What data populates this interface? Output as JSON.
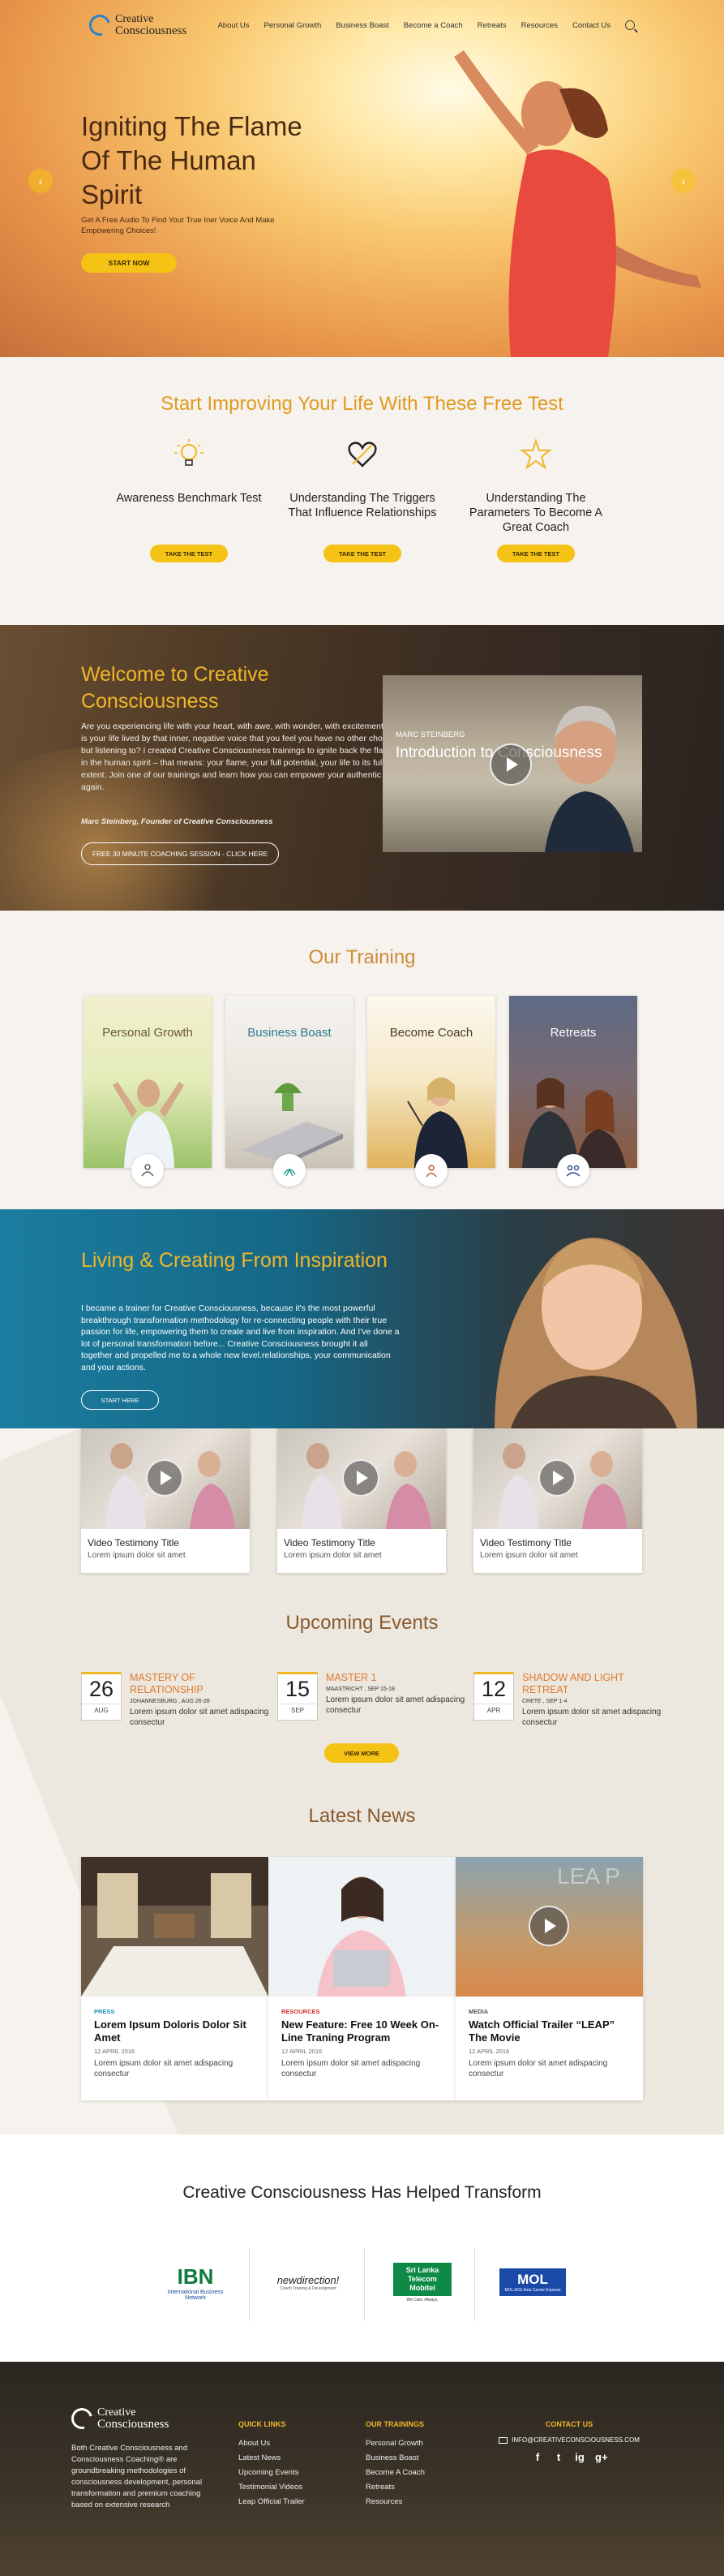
{
  "header": {
    "logo_line1": "Creative",
    "logo_line2": "Consciousness",
    "nav": [
      "About Us",
      "Personal Growth",
      "Business Boast",
      "Become a Coach",
      "Retreats",
      "Resources",
      "Contact Us"
    ]
  },
  "hero": {
    "title": "Igniting The Flame Of The Human Spirit",
    "subtitle": "Get A Free Audio To Find Your True Iner Voice And Make Empowering Choices!",
    "cta": "START NOW",
    "prev": "‹",
    "next": "›"
  },
  "free_test": {
    "title": "Start Improving Your Life With These Free Test",
    "items": [
      {
        "label": "Awareness Benchmark Test",
        "button": "TAKE THE TEST",
        "icon": "lightbulb-icon"
      },
      {
        "label": "Understanding The Triggers That Influence Relationships",
        "button": "TAKE THE TEST",
        "icon": "heart-icon"
      },
      {
        "label": "Understanding The Parameters To Become A Great Coach",
        "button": "TAKE THE TEST",
        "icon": "star-icon"
      }
    ]
  },
  "welcome": {
    "title": "Welcome to Creative Consciousness",
    "body": "Are you experiencing life with your heart, with awe, with wonder, with excitement? Or is your life lived by that inner, negative voice that you feel you have no other choice but listening to? I created Creative Consciousness trainings to ignite back the flame in the human spirit – that means: your flame, your full potential, your life to its fullest extent. Join one of our trainings and learn how you can empower your authentic self again.",
    "author": "Marc Steinberg, Founder of Creative Consciousness",
    "button": "FREE 30 MINUTE COACHING SESSION - CLICK HERE",
    "video_name": "MARC STEINBERG",
    "video_title": "Introduction to Consciousness"
  },
  "training": {
    "title": "Our Training",
    "cards": [
      {
        "label": "Personal Growth",
        "color": "#6a5a2e"
      },
      {
        "label": "Business Boast",
        "color": "#2a7a92"
      },
      {
        "label": "Become Coach",
        "color": "#4a3a22"
      },
      {
        "label": "Retreats",
        "color": "#ffffff"
      }
    ]
  },
  "living": {
    "title": "Living & Creating From Inspiration",
    "body": "I became a trainer for Creative Consciousness, because it's the most powerful breakthrough transformation methodology for re-connecting people with their true passion for life, empowering them to create and live from inspiration. And I've done a lot of personal transformation before... Creative Consciousness brought it all together and propelled me to a whole new level.relationships, your communication and your actions.",
    "button": "START HERE",
    "videos": [
      {
        "title": "Video Testimony Title",
        "desc": "Lorem ipsum dolor sit amet"
      },
      {
        "title": "Video Testimony Title",
        "desc": "Lorem ipsum dolor sit amet"
      },
      {
        "title": "Video Testimony Title",
        "desc": "Lorem ipsum dolor sit amet"
      }
    ]
  },
  "events": {
    "title": "Upcoming Events",
    "button": "VIEW MORE",
    "items": [
      {
        "day": "26",
        "month": "AUG",
        "title": "MASTERY OF RELATIONSHIP",
        "place": "JOHANNESBURG , AUG 26-28",
        "desc": "Lorem ipsum dolor sit amet adispacing consectur"
      },
      {
        "day": "15",
        "month": "SEP",
        "title": "MASTER 1",
        "place": "MAASTRICHT , SEP 15-18",
        "desc": "Lorem ipsum dolor sit amet adispacing consectur"
      },
      {
        "day": "12",
        "month": "APR",
        "title": "SHADOW AND LIGHT RETREAT",
        "place": "CRETE , SEP 1-4",
        "desc": "Lorem ipsum dolor sit amet adispacing consectur"
      }
    ]
  },
  "news": {
    "title": "Latest News",
    "items": [
      {
        "category": "PRESS",
        "cat_color": "#1a8fb0",
        "title": "Lorem Ipsum Doloris Dolor Sit Amet",
        "date": "12 APRIL 2016",
        "desc": "Lorem ipsum dolor sit amet adispacing consectur"
      },
      {
        "category": "RESOURCES",
        "cat_color": "#d0342c",
        "title": "New Feature: Free 10 Week On-Line Traning Program",
        "date": "12 APRIL 2016",
        "desc": "Lorem ipsum dolor sit amet adispacing consectur"
      },
      {
        "category": "MEDIA",
        "cat_color": "#555555",
        "title": "Watch Official Trailer “LEAP” The Movie",
        "date": "12 APRIL 2016",
        "desc": "Lorem ipsum dolor sit amet adispacing consectur",
        "overlay": "LEA P"
      }
    ]
  },
  "partners": {
    "title": "Creative Consciousness Has Helped Transform",
    "logos": [
      {
        "main": "IBN",
        "sub": "International Business Network"
      },
      {
        "main": "newdirection!",
        "sub": "Coach Training & Development"
      },
      {
        "main": "Sri Lanka Telecom Mobitel",
        "sub": "We Care. Always."
      },
      {
        "main": "MOL",
        "sub": "MOL ACE Asia Carrier Express"
      }
    ]
  },
  "footer": {
    "logo_line1": "Creative",
    "logo_line2": "Consciousness",
    "about": "Both Creative Consciousness and Consciousness Coaching® are groundbreaking methodologies of consciousness development, personal transformation and premium coaching based on extensive research",
    "quick_title": "QUICK LINKS",
    "quick_links": [
      "About Us",
      "Latest News",
      "Upcoming Events",
      "Testimonial Videos",
      "Leap Official Trailer"
    ],
    "train_title": "OUR TRAININGS",
    "trainings": [
      "Personal Growth",
      "Business Boast",
      "Become A Coach",
      "Retreats",
      "Resources"
    ],
    "contact_title": "CONTACT US",
    "email": "INFO@CREATIVECONSCIOUSNESS.COM",
    "social": [
      "f",
      "t",
      "ig",
      "g+"
    ]
  },
  "colors": {
    "accent": "#f1b52a",
    "button": "#f5c315",
    "heading_orange": "#e09a1f"
  }
}
